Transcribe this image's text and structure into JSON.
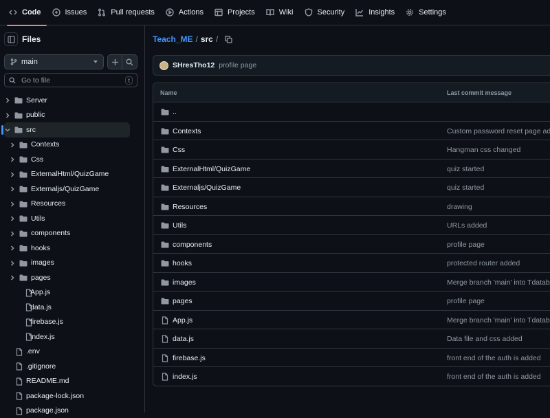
{
  "topnav": {
    "tabs": [
      {
        "label": "Code",
        "icon": "code-icon"
      },
      {
        "label": "Issues",
        "icon": "issue-icon"
      },
      {
        "label": "Pull requests",
        "icon": "pull-request-icon"
      },
      {
        "label": "Actions",
        "icon": "play-icon"
      },
      {
        "label": "Projects",
        "icon": "table-icon"
      },
      {
        "label": "Wiki",
        "icon": "book-icon"
      },
      {
        "label": "Security",
        "icon": "shield-icon"
      },
      {
        "label": "Insights",
        "icon": "graph-icon"
      },
      {
        "label": "Settings",
        "icon": "gear-icon"
      }
    ],
    "active": "Code",
    "accent": "#f78166"
  },
  "sidebar": {
    "title": "Files",
    "branch": "main",
    "goto_placeholder": "Go to file",
    "goto_shortcut": "t",
    "tree": [
      {
        "label": "Server",
        "type": "folder",
        "depth": 0,
        "expanded": false
      },
      {
        "label": "public",
        "type": "folder",
        "depth": 0,
        "expanded": false
      },
      {
        "label": "src",
        "type": "folder",
        "depth": 0,
        "expanded": true,
        "selected": true
      },
      {
        "label": "Contexts",
        "type": "folder",
        "depth": 1,
        "expanded": false
      },
      {
        "label": "Css",
        "type": "folder",
        "depth": 1,
        "expanded": false
      },
      {
        "label": "ExternalHtml/QuizGame",
        "type": "folder",
        "depth": 1,
        "expanded": false
      },
      {
        "label": "Externaljs/QuizGame",
        "type": "folder",
        "depth": 1,
        "expanded": false
      },
      {
        "label": "Resources",
        "type": "folder",
        "depth": 1,
        "expanded": false
      },
      {
        "label": "Utils",
        "type": "folder",
        "depth": 1,
        "expanded": false
      },
      {
        "label": "components",
        "type": "folder",
        "depth": 1,
        "expanded": false
      },
      {
        "label": "hooks",
        "type": "folder",
        "depth": 1,
        "expanded": false
      },
      {
        "label": "images",
        "type": "folder",
        "depth": 1,
        "expanded": false
      },
      {
        "label": "pages",
        "type": "folder",
        "depth": 1,
        "expanded": false
      },
      {
        "label": "App.js",
        "type": "file",
        "depth": 1
      },
      {
        "label": "data.js",
        "type": "file",
        "depth": 1
      },
      {
        "label": "firebase.js",
        "type": "file",
        "depth": 1
      },
      {
        "label": "index.js",
        "type": "file",
        "depth": 1
      },
      {
        "label": ".env",
        "type": "file",
        "depth": 0
      },
      {
        "label": ".gitignore",
        "type": "file",
        "depth": 0
      },
      {
        "label": "README.md",
        "type": "file",
        "depth": 0
      },
      {
        "label": "package-lock.json",
        "type": "file",
        "depth": 0
      },
      {
        "label": "package.json",
        "type": "file",
        "depth": 0
      }
    ]
  },
  "breadcrumb": {
    "repo": "Teach_ME",
    "sep": "/",
    "current": "src",
    "trail": "/"
  },
  "latest_commit": {
    "author": "SHresTho12",
    "message": "profile page"
  },
  "table": {
    "headers": {
      "name": "Name",
      "message": "Last commit message"
    },
    "rows": [
      {
        "name": "..",
        "type": "folder",
        "message": ""
      },
      {
        "name": "Contexts",
        "type": "folder",
        "message": "Custom password reset page added"
      },
      {
        "name": "Css",
        "type": "folder",
        "message": "Hangman css changed"
      },
      {
        "name": "ExternalHtml/QuizGame",
        "type": "folder",
        "message": "quiz started"
      },
      {
        "name": "Externaljs/QuizGame",
        "type": "folder",
        "message": "quiz started"
      },
      {
        "name": "Resources",
        "type": "folder",
        "message": "drawing"
      },
      {
        "name": "Utils",
        "type": "folder",
        "message": "URLs added"
      },
      {
        "name": "components",
        "type": "folder",
        "message": "profile page"
      },
      {
        "name": "hooks",
        "type": "folder",
        "message": "protected router added"
      },
      {
        "name": "images",
        "type": "folder",
        "message": "Merge branch 'main' into Tdatabase"
      },
      {
        "name": "pages",
        "type": "folder",
        "message": "profile page"
      },
      {
        "name": "App.js",
        "type": "file",
        "message": "Merge branch 'main' into Tdatabase"
      },
      {
        "name": "data.js",
        "type": "file",
        "message": "Data file and css added"
      },
      {
        "name": "firebase.js",
        "type": "file",
        "message": "front end of the auth is added"
      },
      {
        "name": "index.js",
        "type": "file",
        "message": "front end of the auth is added"
      }
    ]
  }
}
